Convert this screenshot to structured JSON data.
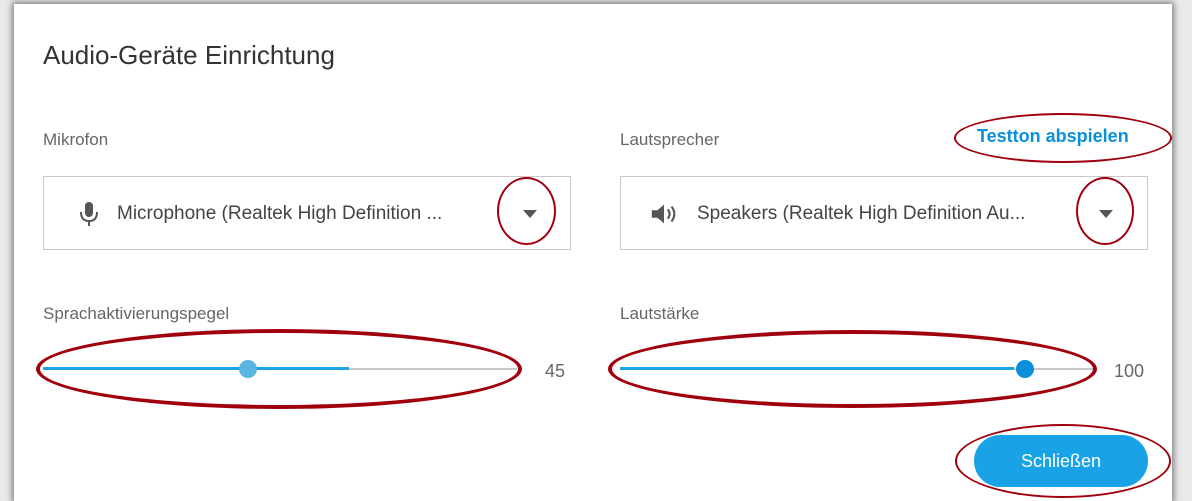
{
  "dialog": {
    "title": "Audio-Geräte Einrichtung",
    "microphone": {
      "label": "Mikrofon",
      "icon": "microphone-icon",
      "selected": "Microphone (Realtek High Definition ..."
    },
    "speaker": {
      "label": "Lautsprecher",
      "icon": "speaker-icon",
      "selected": "Speakers (Realtek High Definition Au...",
      "test_link": "Testton abspielen"
    },
    "voice_activation": {
      "label": "Sprachaktivierungspegel",
      "value": "45",
      "level": 0.45,
      "thumb_color": "#5ab6e0"
    },
    "volume": {
      "label": "Lautstärke",
      "value": "100",
      "level": 1.0,
      "thumb_color": "#0a8fdb"
    },
    "close_button": "Schließen"
  },
  "colors": {
    "accent": "#19a3e6",
    "link": "#0a8fdb",
    "annotation": "#a0000b"
  }
}
